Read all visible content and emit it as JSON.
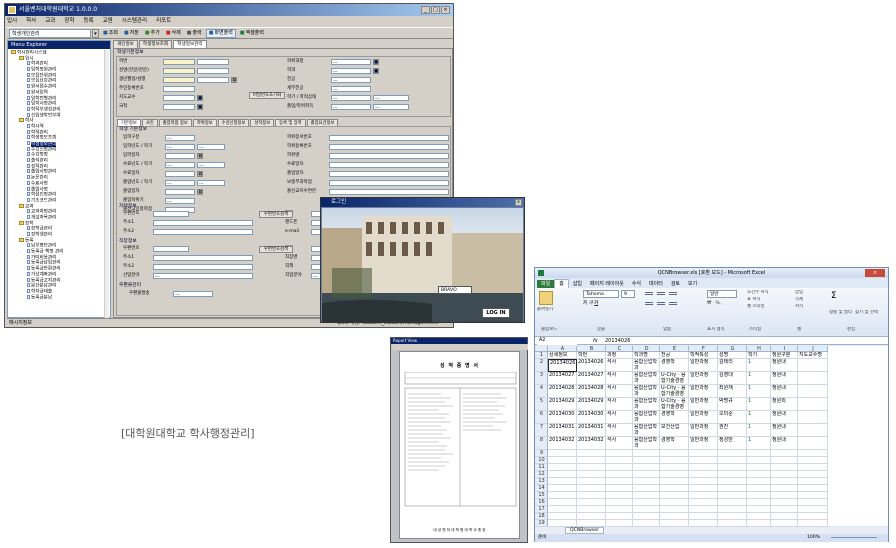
{
  "main": {
    "title": "서울벤처대학원대학교 1.0.0.0",
    "menu": [
      "입시",
      "학사",
      "교과",
      "장학",
      "등록",
      "교원",
      "시스템관리",
      "리포트"
    ],
    "toolbar": {
      "combo_value": "학생개인관리",
      "buttons": [
        "조회",
        "저장",
        "추가",
        "삭제",
        "출력",
        "화면출력",
        "엑셀출력"
      ]
    },
    "tree_title": "Menu Explorer",
    "tree": [
      {
        "label": "학사관리시스템",
        "level": 0,
        "type": "folder"
      },
      {
        "label": "입시",
        "level": 1,
        "type": "folder"
      },
      {
        "label": "학과관리",
        "level": 2,
        "type": "doc"
      },
      {
        "label": "입학정원관리",
        "level": 2,
        "type": "doc"
      },
      {
        "label": "모집단위관리",
        "level": 2,
        "type": "doc"
      },
      {
        "label": "모집요강관리",
        "level": 2,
        "type": "doc"
      },
      {
        "label": "원서접수관리",
        "level": 2,
        "type": "doc"
      },
      {
        "label": "원서입력",
        "level": 2,
        "type": "doc"
      },
      {
        "label": "입학전형관리",
        "level": 2,
        "type": "doc"
      },
      {
        "label": "입학사정관리",
        "level": 2,
        "type": "doc"
      },
      {
        "label": "학적부생성관리",
        "level": 2,
        "type": "doc"
      },
      {
        "label": "신입생학번부여",
        "level": 2,
        "type": "doc"
      },
      {
        "label": "학사",
        "level": 1,
        "type": "folder"
      },
      {
        "label": "학사력",
        "level": 2,
        "type": "doc"
      },
      {
        "label": "학적관리",
        "level": 2,
        "type": "doc"
      },
      {
        "label": "학생정보조회",
        "level": 2,
        "type": "doc"
      },
      {
        "label": "학생정보관리",
        "level": 2,
        "type": "doc",
        "selected": true
      },
      {
        "label": "수강신청관리",
        "level": 2,
        "type": "doc"
      },
      {
        "label": "수강정정",
        "level": 2,
        "type": "doc"
      },
      {
        "label": "출석관리",
        "level": 2,
        "type": "doc"
      },
      {
        "label": "성적관리",
        "level": 2,
        "type": "doc"
      },
      {
        "label": "졸업사정관리",
        "level": 2,
        "type": "doc"
      },
      {
        "label": "논문관리",
        "level": 2,
        "type": "doc"
      },
      {
        "label": "수료사정",
        "level": 2,
        "type": "doc"
      },
      {
        "label": "졸업사정",
        "level": 2,
        "type": "doc"
      },
      {
        "label": "학점인정관리",
        "level": 2,
        "type": "doc"
      },
      {
        "label": "기초코드관리",
        "level": 2,
        "type": "doc"
      },
      {
        "label": "교과",
        "level": 1,
        "type": "folder"
      },
      {
        "label": "교과과정관리",
        "level": 2,
        "type": "doc"
      },
      {
        "label": "개설과목관리",
        "level": 2,
        "type": "doc"
      },
      {
        "label": "장학",
        "level": 1,
        "type": "folder"
      },
      {
        "label": "장학금관리",
        "level": 2,
        "type": "doc"
      },
      {
        "label": "장학생관리",
        "level": 2,
        "type": "doc"
      },
      {
        "label": "등록",
        "level": 1,
        "type": "folder"
      },
      {
        "label": "납부명단관리",
        "level": 2,
        "type": "doc"
      },
      {
        "label": "등록금 책정 관리",
        "level": 2,
        "type": "doc"
      },
      {
        "label": "가티비용관리",
        "level": 2,
        "type": "doc"
      },
      {
        "label": "등록금납입관리",
        "level": 2,
        "type": "doc"
      },
      {
        "label": "등록금반환관리",
        "level": 2,
        "type": "doc"
      },
      {
        "label": "가상계좌관리",
        "level": 2,
        "type": "doc"
      },
      {
        "label": "등록금고지관리",
        "level": 2,
        "type": "doc"
      },
      {
        "label": "분산분납관리",
        "level": 2,
        "type": "doc"
      },
      {
        "label": "학자금대출",
        "level": 2,
        "type": "doc"
      },
      {
        "label": "등록금분납",
        "level": 2,
        "type": "doc"
      }
    ],
    "tabs": [
      "개인정보",
      "학생정보조회",
      "학생정보관리"
    ],
    "basic_group": "학생기본정보",
    "basic_left": [
      "학번",
      "성명(한글/한문)",
      "생년월일/성별",
      "주민등록번호",
      "지도교수",
      "국적"
    ],
    "basic_right": [
      "학위과정",
      "학과",
      "전공",
      "세부전공",
      "학기 / 학적상태",
      "졸업/학위취득"
    ],
    "photo_button": "비밀번호초기화",
    "subtabs": [
      "기본정보",
      "사진",
      "졸업학점 정보",
      "학위정보",
      "수강신청정보",
      "성적정보",
      "등록 및 장학",
      "졸업요건정보"
    ],
    "detail_group": "학생 기본정보",
    "detail_left": [
      "입학구분",
      "입학년도 / 학기",
      "입학일자",
      "수료년도 / 학기",
      "수료일자",
      "졸업년도 / 학기",
      "졸업일자",
      "졸업학위기",
      "졸신고인정학점"
    ],
    "detail_right": [
      "학위증서번호",
      "학위등록번호",
      "학위명",
      "수료일자",
      "졸업일자",
      "보충부과학점",
      "졸신교이수연한"
    ],
    "home_group": "자택정보",
    "home_labels": [
      "우편번호",
      "주소1",
      "주소2"
    ],
    "home_right": [
      "전화",
      "핸드폰",
      "e-mail"
    ],
    "zip_button": "우편번호검색",
    "work_group": "직장정보",
    "work_labels": [
      "우편번호",
      "주소1",
      "주소2",
      "산업분야"
    ],
    "work_right": [
      "전화",
      "직장명",
      "직책",
      "직업분야"
    ],
    "ask_group": "우편물관리",
    "ask_label": "우편물발송",
    "status_left": "메시지정보",
    "status_right": "QCN 계정: student_studentmanager.html"
  },
  "login": {
    "title": "로그인",
    "overlay_text": "BRAVO",
    "button": "LOG IN"
  },
  "report": {
    "title": "Report View",
    "doc_title": "성 적 증 명 서",
    "footer": "대 성 벤 처 대 학 원 대 학 교 총 장"
  },
  "excel": {
    "title": "QCNBrowser.xls [호환 모드] - Microsoft Excel",
    "tabs": [
      "파일",
      "홈",
      "삽입",
      "페이지 레이아웃",
      "수식",
      "데이터",
      "검토",
      "보기"
    ],
    "font": "Tahoma",
    "size": "9",
    "numfmt": "일반",
    "groups": [
      "클립보드",
      "글꼴",
      "맞춤",
      "표시 형식",
      "스타일",
      "셀",
      "편집"
    ],
    "paste": "붙여넣기",
    "styles": [
      "조건부 서식",
      "표 서식",
      "셀 스타일"
    ],
    "cellops": [
      "삽입",
      "삭제",
      "서식"
    ],
    "edit": [
      "정렬 및 필터",
      "찾기 및 선택"
    ],
    "namebox": "A2",
    "formula": "20134026",
    "cols": [
      "A",
      "B",
      "C",
      "D",
      "E",
      "F",
      "G",
      "H",
      "I",
      "J"
    ],
    "headers": [
      "상세정보",
      "학번",
      "과정",
      "학과명",
      "전공",
      "학적특성",
      "성명",
      "학기",
      "정원구분",
      "지도교수명"
    ],
    "rows": [
      [
        "20134026",
        "20134026",
        "석사",
        "융합신업학과",
        "경영학",
        "일반과정",
        "김태리",
        "1",
        "정원내",
        ""
      ],
      [
        "20134027",
        "20134027",
        "석사",
        "융합산업학과",
        "U-City · 융합기술경영",
        "일반과정",
        "김영대",
        "1",
        "정원내",
        ""
      ],
      [
        "20134028",
        "20134028",
        "석사",
        "융합산업학과",
        "U-City · 융합기술경영",
        "일반과정",
        "최원재",
        "1",
        "정원내",
        ""
      ],
      [
        "20134029",
        "20134029",
        "석사",
        "융합산업학과",
        "U-City · 융합기술경영",
        "일반과정",
        "박명규",
        "1",
        "정원외",
        ""
      ],
      [
        "20134030",
        "20134030",
        "석사",
        "융합산업학과",
        "경영학",
        "일반과정",
        "오미순",
        "1",
        "정원내",
        ""
      ],
      [
        "20134031",
        "20134031",
        "석사",
        "융합산업학과",
        "보건산업",
        "일반과정",
        "권진",
        "1",
        "정원내",
        ""
      ],
      [
        "20134032",
        "20134032",
        "석사",
        "융합산업학과",
        "경영학",
        "일반과정",
        "정성만",
        "1",
        "정원내",
        ""
      ]
    ],
    "row_numbers": [
      "1",
      "2",
      "3",
      "4",
      "5",
      "6",
      "7",
      "8",
      "9",
      "10",
      "11",
      "12",
      "13",
      "14",
      "15",
      "16",
      "17",
      "18",
      "19",
      "20",
      "21"
    ],
    "sheet": "QCNBrowser",
    "status": "준비",
    "zoom": "100%"
  },
  "caption": "[대학원대학교 학사행정관리]"
}
